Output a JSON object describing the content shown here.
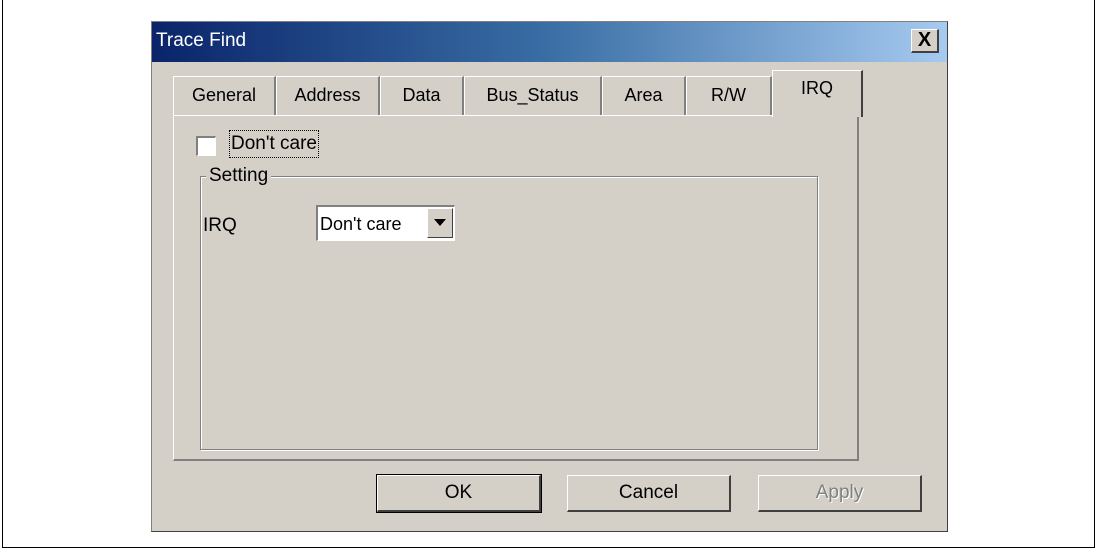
{
  "window": {
    "title": "Trace Find",
    "close_glyph": "X"
  },
  "tabs": [
    {
      "label": "General",
      "active": false
    },
    {
      "label": "Address",
      "active": false
    },
    {
      "label": "Data",
      "active": false
    },
    {
      "label": "Bus_Status",
      "active": false
    },
    {
      "label": "Area",
      "active": false
    },
    {
      "label": "R/W",
      "active": false
    },
    {
      "label": "IRQ",
      "active": true
    }
  ],
  "panel": {
    "dont_care_label": "Don't care",
    "dont_care_checked": false,
    "group_label": "Setting",
    "irq_label": "IRQ",
    "irq_select_value": "Don't care"
  },
  "buttons": {
    "ok": "OK",
    "cancel": "Cancel",
    "apply": "Apply"
  },
  "colors": {
    "title_gradient_start": "#0a246a",
    "title_gradient_end": "#a6caf0",
    "dialog_face": "#d4d0c8",
    "disabled_text": "#808080"
  }
}
